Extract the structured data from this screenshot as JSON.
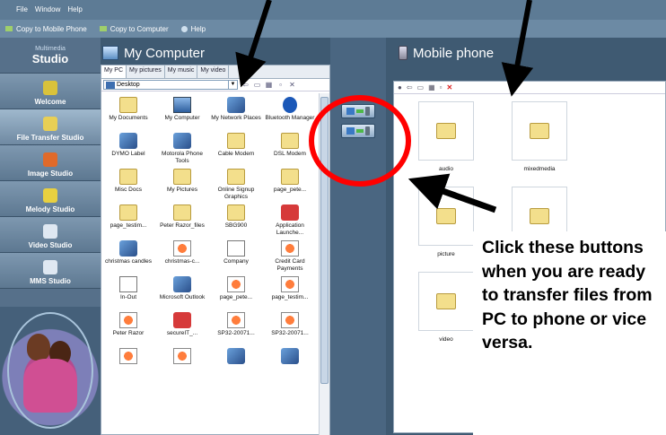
{
  "menubar": [
    "File",
    "Window",
    "Help"
  ],
  "toolbar": {
    "copy_to_phone": "Copy to Mobile Phone",
    "copy_to_computer": "Copy to Computer",
    "help": "Help"
  },
  "studio": {
    "brand_small": "Multimedia",
    "brand_large": "Studio",
    "items": [
      {
        "label": "Welcome",
        "icon": "welcome-icon",
        "color": "#d9c23a"
      },
      {
        "label": "File Transfer Studio",
        "icon": "file-transfer-icon",
        "color": "#e8cf55"
      },
      {
        "label": "Image Studio",
        "icon": "image-studio-icon",
        "color": "#e06a2a"
      },
      {
        "label": "Melody Studio",
        "icon": "melody-icon",
        "color": "#e8d040"
      },
      {
        "label": "Video Studio",
        "icon": "video-icon",
        "color": "#dfe8f2"
      },
      {
        "label": "MMS Studio",
        "icon": "mms-icon",
        "color": "#dfe8f2"
      }
    ]
  },
  "my_computer": {
    "title": "My Computer",
    "tabs": [
      "My PC",
      "My pictures",
      "My music",
      "My video"
    ],
    "path": "Desktop",
    "files": [
      {
        "name": "My Documents",
        "icon": "folder"
      },
      {
        "name": "My Computer",
        "icon": "pc"
      },
      {
        "name": "My Network Places",
        "icon": "app"
      },
      {
        "name": "Bluetooth Manager",
        "icon": "bt"
      },
      {
        "name": "DYMO Label",
        "icon": "app"
      },
      {
        "name": "Motorola Phone Tools",
        "icon": "app"
      },
      {
        "name": "Cable Modem",
        "icon": "folder"
      },
      {
        "name": "DSL Modem",
        "icon": "folder"
      },
      {
        "name": "Misc Docs",
        "icon": "folder"
      },
      {
        "name": "My Pictures",
        "icon": "folder"
      },
      {
        "name": "Online Signup Graphics",
        "icon": "folder"
      },
      {
        "name": "page_pete...",
        "icon": "folder"
      },
      {
        "name": "page_testim...",
        "icon": "folder"
      },
      {
        "name": "Peter Razor_files",
        "icon": "folder"
      },
      {
        "name": "SBG900",
        "icon": "folder"
      },
      {
        "name": "Application Launche...",
        "icon": "red"
      },
      {
        "name": "christmas candles",
        "icon": "app"
      },
      {
        "name": "christmas-c...",
        "icon": "ie"
      },
      {
        "name": "Company",
        "icon": "doc"
      },
      {
        "name": "Credit Card Payments",
        "icon": "ie"
      },
      {
        "name": "In-Out",
        "icon": "doc"
      },
      {
        "name": "Microsoft Outlook",
        "icon": "app"
      },
      {
        "name": "page_pete...",
        "icon": "ie"
      },
      {
        "name": "page_testim...",
        "icon": "ie"
      },
      {
        "name": "Peter Razor",
        "icon": "ie"
      },
      {
        "name": "secureIT_...",
        "icon": "red"
      },
      {
        "name": "SP32-20071...",
        "icon": "ie"
      },
      {
        "name": "SP32-20071...",
        "icon": "ie"
      },
      {
        "name": "",
        "icon": "ie"
      },
      {
        "name": "",
        "icon": "ie"
      },
      {
        "name": "",
        "icon": "app"
      },
      {
        "name": "",
        "icon": "app"
      }
    ]
  },
  "mobile_phone": {
    "title": "Mobile phone",
    "folders": [
      "audio",
      "mixedmedia",
      "picture",
      "",
      "video"
    ]
  },
  "annotation": {
    "text": "Click these buttons when you are ready to transfer files from PC to phone or vice versa.",
    "circle_color": "#ff0000"
  }
}
